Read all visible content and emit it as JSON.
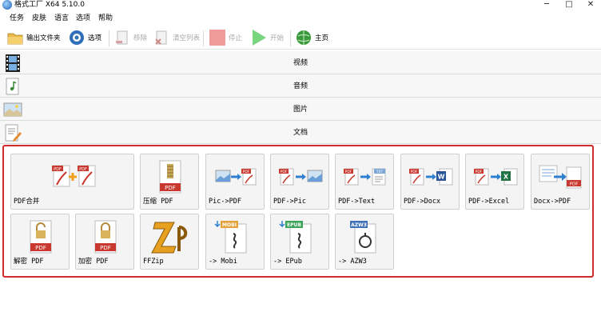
{
  "window": {
    "title": "格式工厂 X64 5.10.0",
    "controls": [
      "─",
      "□",
      "✕"
    ]
  },
  "menu": [
    "任务",
    "皮肤",
    "语言",
    "选项",
    "帮助"
  ],
  "toolbar": {
    "output_folder": "输出文件夹",
    "options": "选项",
    "remove": "移除",
    "clear_list": "清空列表",
    "stop": "停止",
    "start": "开始",
    "home": "主页"
  },
  "categories": [
    "视频",
    "音频",
    "图片",
    "文档"
  ],
  "tools": {
    "pdf_merge": "PDF合并",
    "pdf_compress": "压缩 PDF",
    "pic_to_pdf": "Pic->PDF",
    "pdf_to_pic": "PDF->Pic",
    "pdf_to_text": "PDF->Text",
    "pdf_to_docx": "PDF->Docx",
    "pdf_to_excel": "PDF->Excel",
    "docx_to_pdf": "Docx->PDF",
    "decrypt_pdf": "解密 PDF",
    "encrypt_pdf": "加密 PDF",
    "ffzip": "FFZip",
    "to_mobi": "-> Mobi",
    "to_epub": "-> EPub",
    "to_azw3": "-> AZW3"
  },
  "badges": {
    "pdf": "PDF",
    "txt": "TXT",
    "w": "W",
    "x": "X",
    "mobi": "MOBI",
    "epub": "EPUB",
    "azw3": "AZW3"
  },
  "colors": {
    "highlight_border": "#d42a2a",
    "pdf_red": "#c9382e",
    "start_green": "#3cc24a"
  }
}
